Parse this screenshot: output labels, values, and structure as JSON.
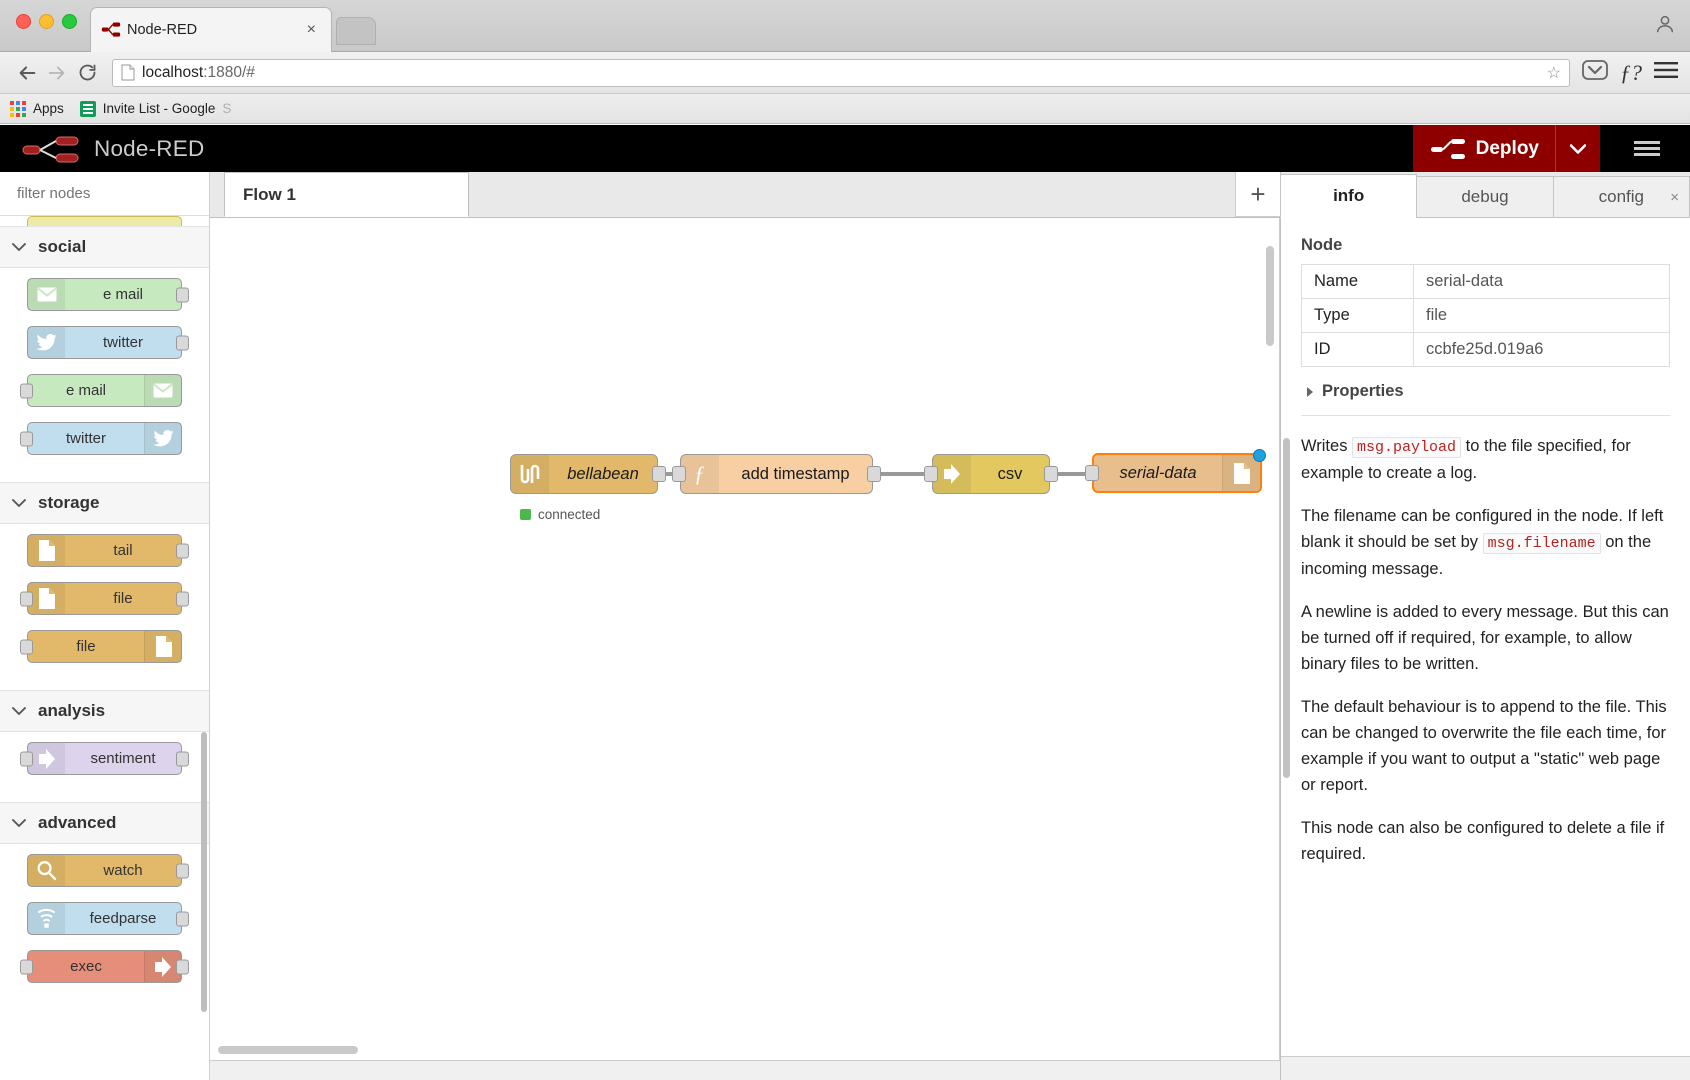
{
  "browser": {
    "tab_title": "Node-RED",
    "tab_close": "×",
    "url_host": "localhost",
    "url_rest": ":1880/#",
    "star_icon": "☆",
    "fx_label": "ƒ?",
    "bookmarks": [
      {
        "label": "Apps",
        "icon": "apps-grid-icon"
      },
      {
        "label": "Invite List - Google ",
        "label_faded": "S",
        "icon": "google-sheets-icon"
      }
    ]
  },
  "app": {
    "brand": "Node-RED",
    "deploy_label": "Deploy"
  },
  "palette": {
    "search_placeholder": "filter nodes",
    "categories": [
      {
        "name": "social",
        "nodes": [
          {
            "label": "e mail",
            "icon": "envelope-icon",
            "color": "c-green",
            "ports": "out"
          },
          {
            "label": "twitter",
            "icon": "twitter-icon",
            "color": "c-blue",
            "ports": "out"
          },
          {
            "label": "e mail",
            "icon": "envelope-icon",
            "color": "c-green",
            "ports": "in"
          },
          {
            "label": "twitter",
            "icon": "twitter-icon",
            "color": "c-blue",
            "ports": "in"
          }
        ]
      },
      {
        "name": "storage",
        "nodes": [
          {
            "label": "tail",
            "icon": "file-icon",
            "color": "c-tan",
            "ports": "out"
          },
          {
            "label": "file",
            "icon": "file-icon",
            "color": "c-tan",
            "ports": "both"
          },
          {
            "label": "file",
            "icon": "file-icon",
            "color": "c-tan",
            "ports": "in"
          }
        ]
      },
      {
        "name": "analysis",
        "nodes": [
          {
            "label": "sentiment",
            "icon": "arrow-icon",
            "color": "c-purple",
            "ports": "both"
          }
        ]
      },
      {
        "name": "advanced",
        "nodes": [
          {
            "label": "watch",
            "icon": "magnifier-icon",
            "color": "c-tan",
            "ports": "out"
          },
          {
            "label": "feedparse",
            "icon": "rss-icon",
            "color": "c-blue",
            "ports": "out"
          },
          {
            "label": "exec",
            "icon": "arrow-icon",
            "color": "c-salmon",
            "ports": "in"
          }
        ]
      }
    ]
  },
  "workspace": {
    "tab_label": "Flow 1",
    "add_tab_label": "+",
    "nodes": [
      {
        "label": "bellabean",
        "icon": "pulse-icon",
        "color": "#e2b96a",
        "status": "connected",
        "selected": false
      },
      {
        "label": "add timestamp",
        "icon": "function-icon",
        "color": "#f7cfa3",
        "selected": false
      },
      {
        "label": "csv",
        "icon": "arrow-icon",
        "color": "#e3c860",
        "selected": false
      },
      {
        "label": "serial-data",
        "icon": "file-icon",
        "color": "#e8bf8c",
        "selected": true
      }
    ]
  },
  "sidebar": {
    "tabs": [
      {
        "label": "info",
        "active": true,
        "closable": false
      },
      {
        "label": "debug",
        "active": false,
        "closable": false
      },
      {
        "label": "config",
        "active": false,
        "closable": true,
        "close_glyph": "×"
      }
    ],
    "section_heading": "Node",
    "node_info": [
      {
        "key": "Name",
        "value": "serial-data"
      },
      {
        "key": "Type",
        "value": "file"
      },
      {
        "key": "ID",
        "value": "ccbfe25d.019a6"
      }
    ],
    "properties_label": "Properties",
    "help_paragraphs": [
      {
        "parts": [
          {
            "t": "Writes "
          },
          {
            "t": "msg.payload",
            "code": true
          },
          {
            "t": " to the file specified, for example to create a log."
          }
        ]
      },
      {
        "parts": [
          {
            "t": "The filename can be configured in the node. If left blank it should be set by "
          },
          {
            "t": "msg.filename",
            "code": true
          },
          {
            "t": " on the incoming message."
          }
        ]
      },
      {
        "parts": [
          {
            "t": "A newline is added to every message. But this can be turned off if required, for example, to allow binary files to be written."
          }
        ]
      },
      {
        "parts": [
          {
            "t": "The default behaviour is to append to the file. This can be changed to overwrite the file each time, for example if you want to output a \"static\" web page or report."
          }
        ]
      },
      {
        "parts": [
          {
            "t": "This node can also be configured to delete a file if required."
          }
        ]
      }
    ]
  }
}
